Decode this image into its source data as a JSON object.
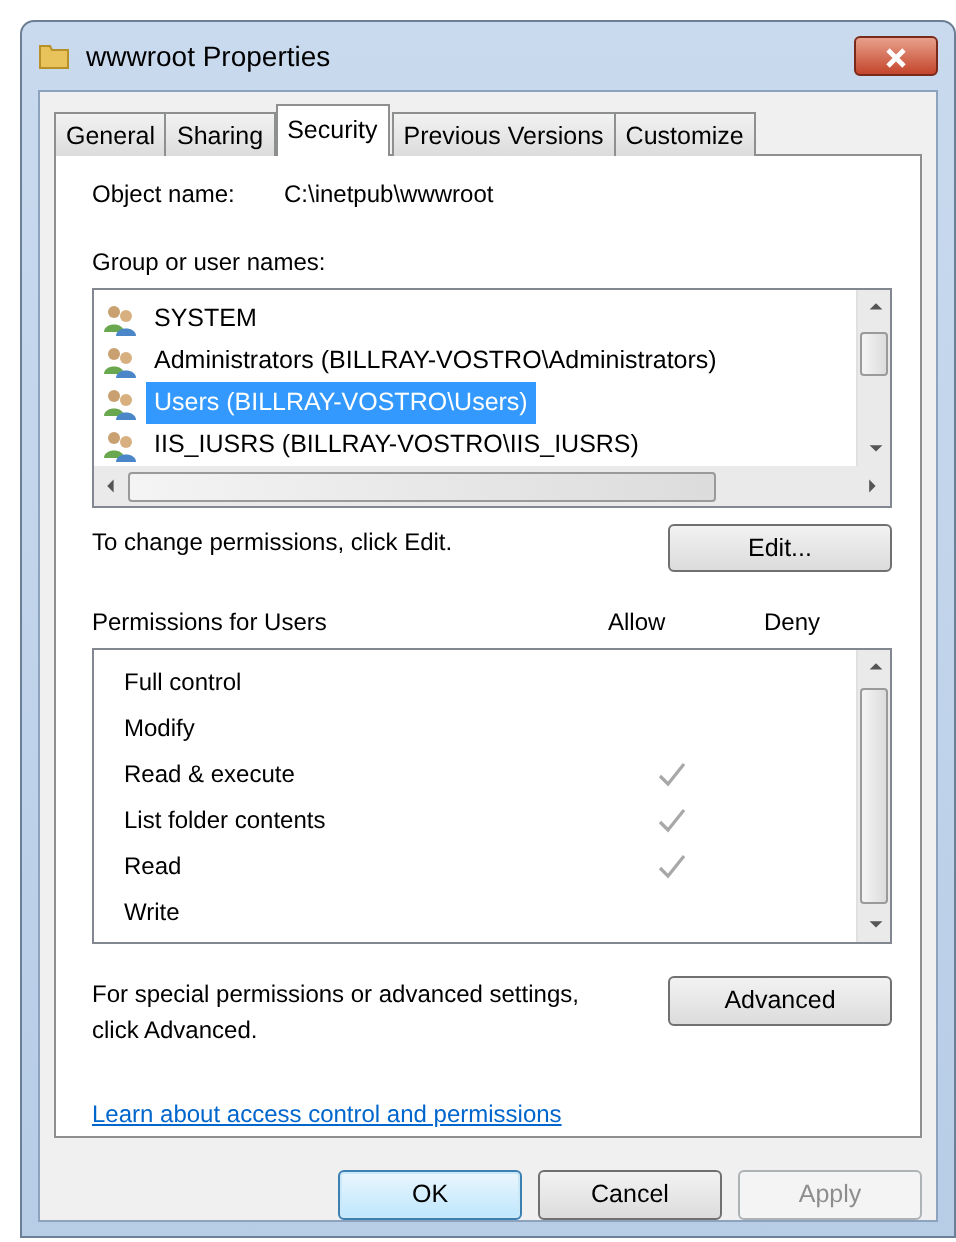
{
  "window": {
    "title": "wwwroot Properties"
  },
  "tabs": [
    {
      "label": "General",
      "selected": false
    },
    {
      "label": "Sharing",
      "selected": false
    },
    {
      "label": "Security",
      "selected": true
    },
    {
      "label": "Previous Versions",
      "selected": false
    },
    {
      "label": "Customize",
      "selected": false
    }
  ],
  "object_name": {
    "label": "Object name:",
    "value": "C:\\inetpub\\wwwroot"
  },
  "group_list": {
    "label": "Group or user names:",
    "items": [
      {
        "name": "SYSTEM",
        "selected": false
      },
      {
        "name": "Administrators (BILLRAY-VOSTRO\\Administrators)",
        "selected": false
      },
      {
        "name": "Users (BILLRAY-VOSTRO\\Users)",
        "selected": true
      },
      {
        "name": "IIS_IUSRS (BILLRAY-VOSTRO\\IIS_IUSRS)",
        "selected": false
      }
    ]
  },
  "change_hint": "To change permissions, click Edit.",
  "edit_button": "Edit...",
  "permissions": {
    "label": "Permissions for Users",
    "allow_header": "Allow",
    "deny_header": "Deny",
    "rows": [
      {
        "name": "Full control",
        "allow": false,
        "deny": false
      },
      {
        "name": "Modify",
        "allow": false,
        "deny": false
      },
      {
        "name": "Read & execute",
        "allow": true,
        "deny": false
      },
      {
        "name": "List folder contents",
        "allow": true,
        "deny": false
      },
      {
        "name": "Read",
        "allow": true,
        "deny": false
      },
      {
        "name": "Write",
        "allow": false,
        "deny": false
      }
    ]
  },
  "advanced_hint": "For special permissions or advanced settings, click Advanced.",
  "advanced_button": "Advanced",
  "learn_link": "Learn about access control and permissions",
  "buttons": [
    {
      "label": "OK",
      "default": true,
      "disabled": false
    },
    {
      "label": "Cancel",
      "default": false,
      "disabled": false
    },
    {
      "label": "Apply",
      "default": false,
      "disabled": true
    }
  ]
}
